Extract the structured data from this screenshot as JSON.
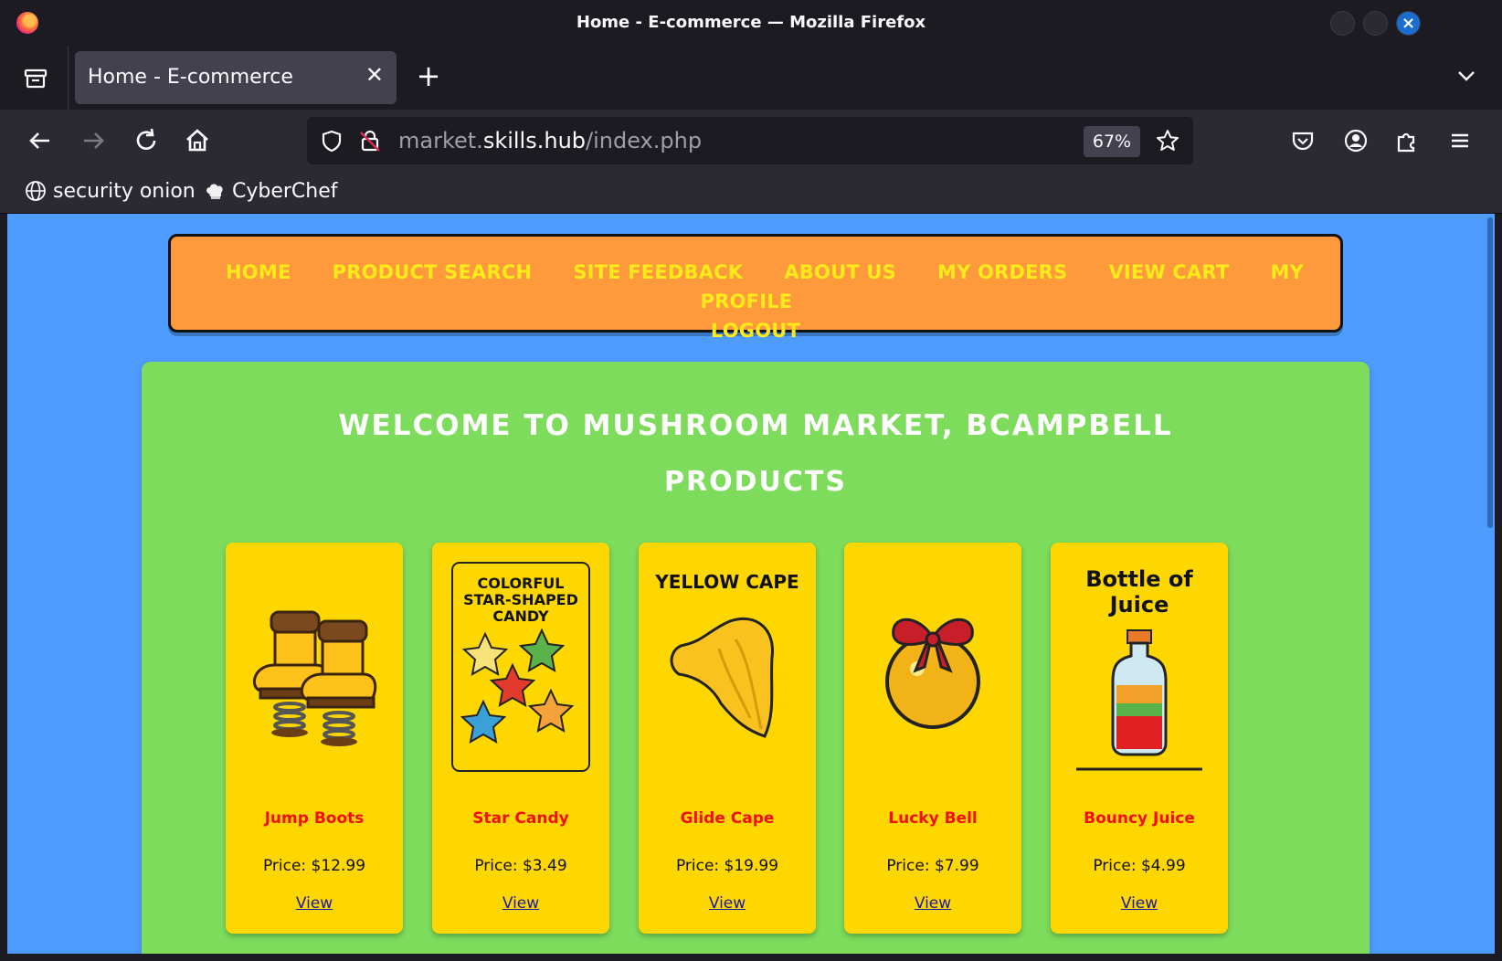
{
  "window": {
    "title": "Home - E-commerce — Mozilla Firefox"
  },
  "tabs": [
    {
      "label": "Home - E-commerce",
      "active": true
    }
  ],
  "urlbar": {
    "url_prefix": "market.",
    "url_host": "skills.hub",
    "url_path": "/index.php",
    "zoom": "67%"
  },
  "bookmarks": [
    {
      "label": "security onion",
      "icon": "globe-icon"
    },
    {
      "label": "CyberChef",
      "icon": "chef-hat-icon"
    }
  ],
  "site": {
    "nav": [
      "HOME",
      "PRODUCT SEARCH",
      "SITE FEEDBACK",
      "ABOUT US",
      "MY ORDERS",
      "VIEW CART",
      "MY PROFILE",
      "LOGOUT"
    ],
    "welcome": "WELCOME TO MUSHROOM MARKET, BCAMPBELL",
    "products_heading": "PRODUCTS",
    "view_label": "View",
    "products": [
      {
        "name": "Jump Boots",
        "price": "Price: $12.99",
        "image_caption": ""
      },
      {
        "name": "Star Candy",
        "price": "Price: $3.49",
        "image_caption": "COLORFUL STAR-SHAPED CANDY"
      },
      {
        "name": "Glide Cape",
        "price": "Price: $19.99",
        "image_caption": "YELLOW CAPE"
      },
      {
        "name": "Lucky Bell",
        "price": "Price: $7.99",
        "image_caption": ""
      },
      {
        "name": "Bouncy Juice",
        "price": "Price: $4.99",
        "image_caption": "Bottle of Juice"
      }
    ]
  },
  "colors": {
    "page_bg": "#4e9cff",
    "nav_bg": "#ff9a3c",
    "nav_text": "#ffeb1a",
    "panel_bg": "#7ddc5b",
    "card_bg": "#ffd700",
    "product_name": "#f20f0f"
  }
}
